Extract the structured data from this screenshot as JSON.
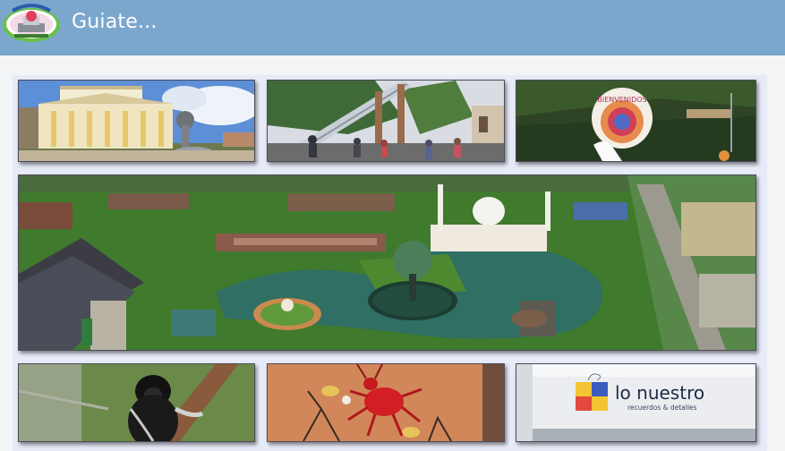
{
  "app": {
    "title": "Guiate..."
  },
  "logo": {
    "icon": "park-logo-icon"
  },
  "gallery": {
    "tiles": [
      {
        "name": "tile-palace",
        "caption": ""
      },
      {
        "name": "tile-slide",
        "caption": ""
      },
      {
        "name": "tile-welcome",
        "caption": "BIENVENIDOS"
      },
      {
        "name": "tile-miniature-park",
        "caption": ""
      },
      {
        "name": "tile-monkey",
        "caption": ""
      },
      {
        "name": "tile-insect",
        "caption": ""
      },
      {
        "name": "tile-store",
        "store_name": "lo nuestro",
        "store_tagline": "recuerdos & detalles"
      }
    ]
  },
  "colors": {
    "appbar": "#7ba7cd",
    "background": "#f2f4f6",
    "grid": "#e7ebf8"
  }
}
